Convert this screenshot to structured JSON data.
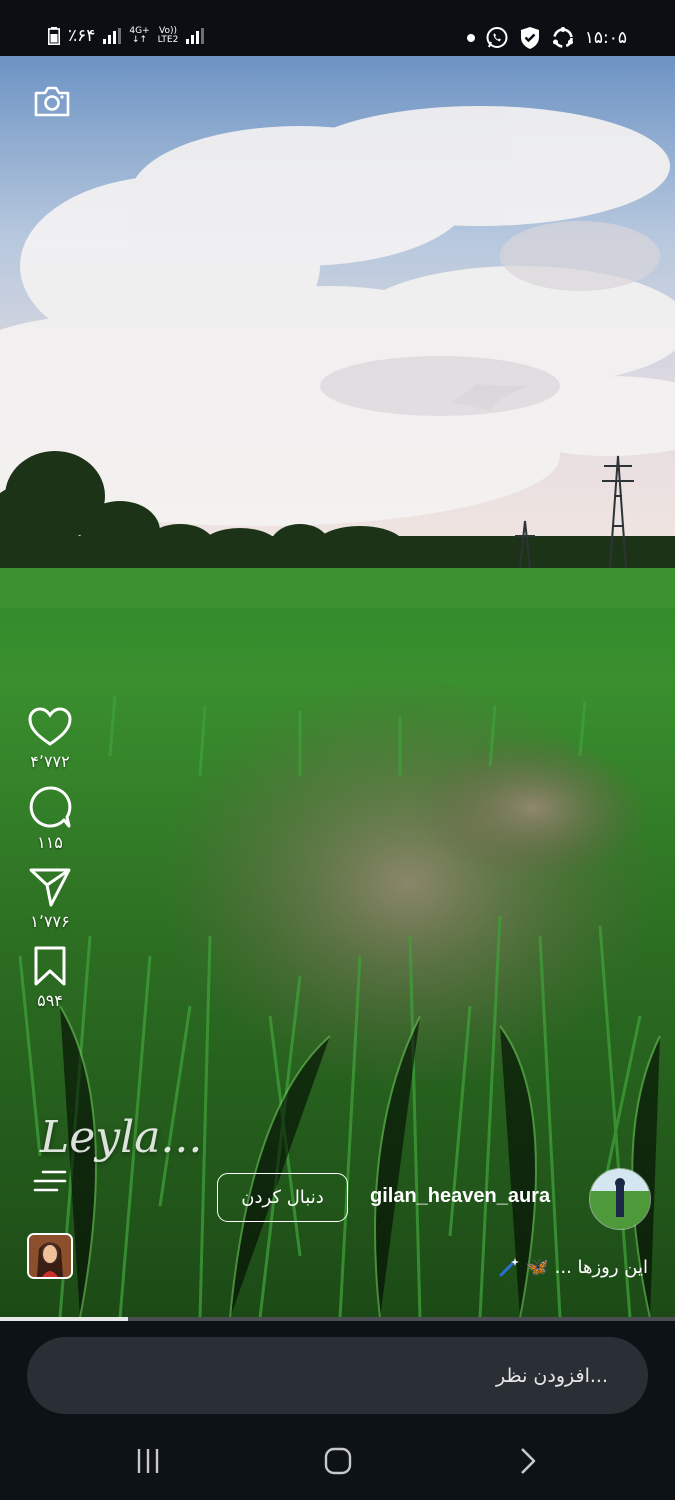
{
  "status_bar": {
    "battery": "٪۶۴",
    "network_top": "4G+",
    "network_bottom": "LTE2",
    "volte": "Vo))",
    "time": "۱۵:۰۵"
  },
  "actions": {
    "likes": "۴٬۷۷۲",
    "comments": "۱۱۵",
    "shares": "۱٬۷۷۶",
    "saves": "۵۹۴"
  },
  "watermark": "Leyla...",
  "author": {
    "username": "gilan_heaven_aura",
    "follow_label": "دنبال کردن"
  },
  "caption": {
    "text": "این روزها ...",
    "emoji": "🦋"
  },
  "video_progress": 0.19,
  "comment_placeholder": "افزودن نظر...",
  "icons": {
    "camera": "camera-icon",
    "like": "heart-icon",
    "comment": "comment-icon",
    "share": "send-icon",
    "save": "bookmark-icon",
    "menu": "menu-icon",
    "nav_recents": "recents-icon",
    "nav_home": "home-icon",
    "nav_back": "back-icon"
  }
}
